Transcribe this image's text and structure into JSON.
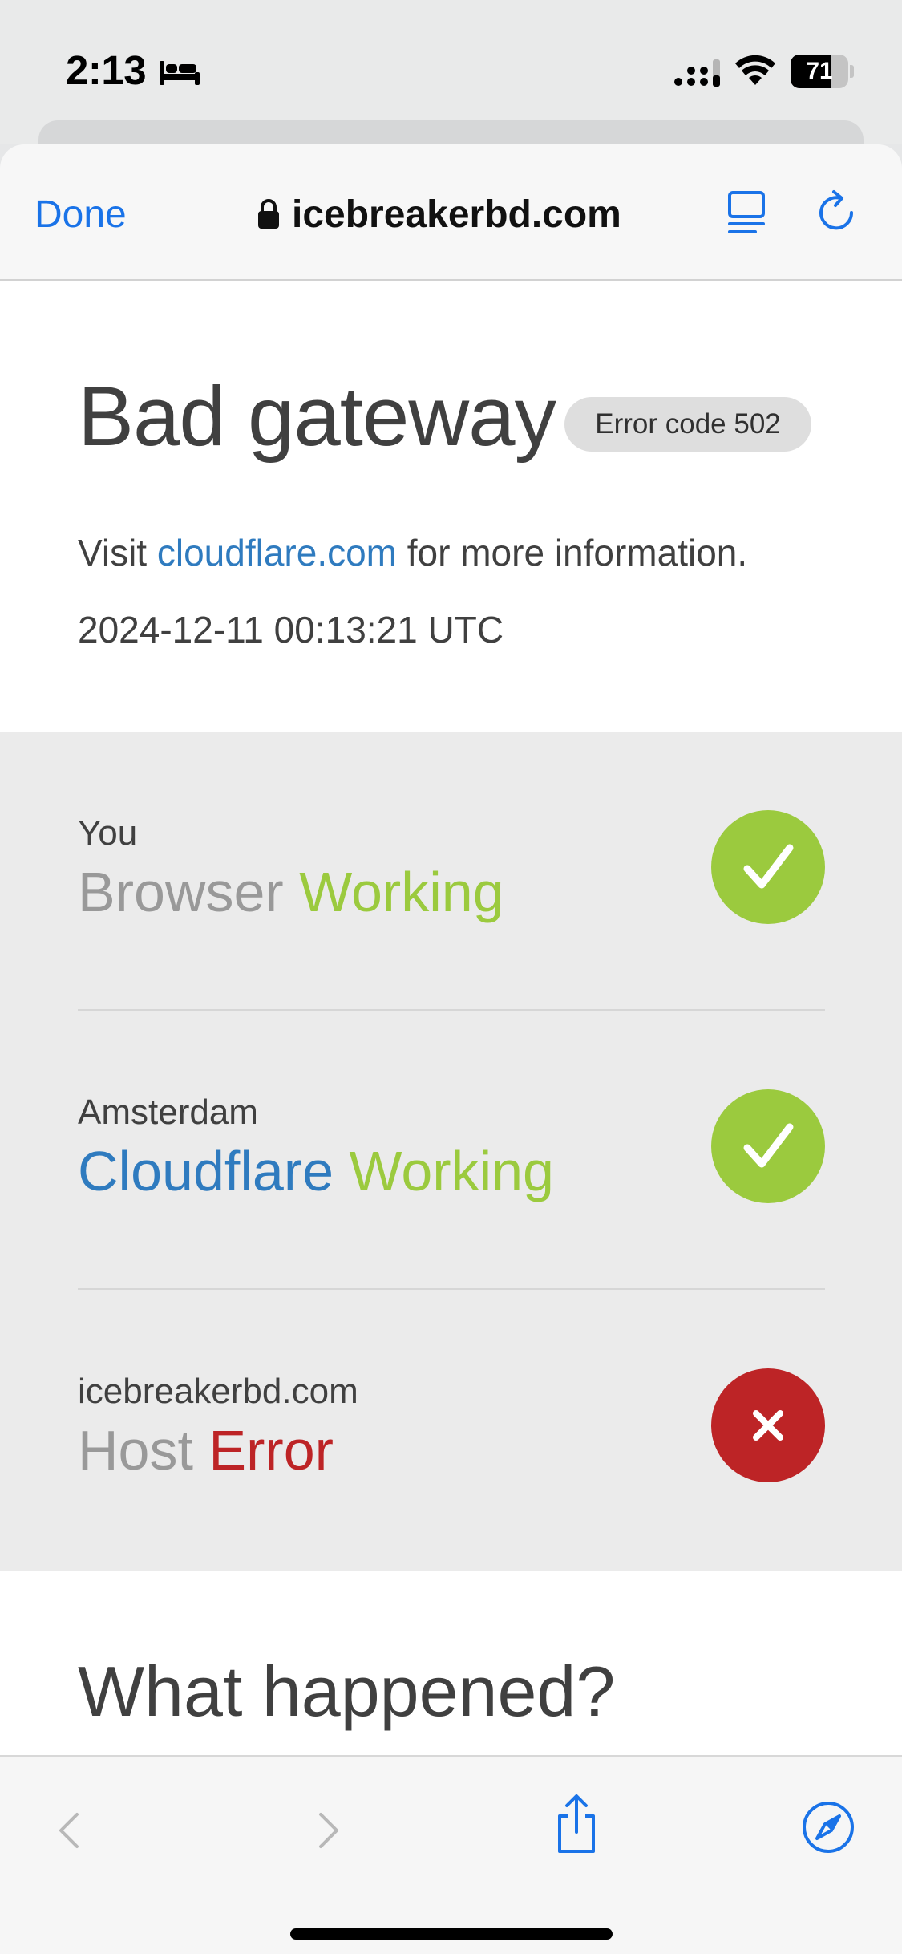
{
  "status_bar": {
    "time": "2:13",
    "battery_level": "71",
    "battery_fraction": 0.71
  },
  "browser": {
    "done_label": "Done",
    "url": "icebreakerbd.com",
    "accent_color": "#1a73e8"
  },
  "page": {
    "title": "Bad gateway",
    "error_badge": "Error code 502",
    "info_prefix": "Visit ",
    "info_link": "cloudflare.com",
    "info_suffix": " for more information.",
    "timestamp": "2024-12-11 00:13:21 UTC",
    "status_rows": [
      {
        "location": "You",
        "entity": "Browser",
        "state": "Working",
        "icon": "check-icon",
        "color": "#9bca3e"
      },
      {
        "location": "Amsterdam",
        "entity": "Cloudflare",
        "state": "Working",
        "icon": "check-icon",
        "color": "#9bca3e"
      },
      {
        "location": "icebreakerbd.com",
        "entity": "Host",
        "state": "Error",
        "icon": "x-icon",
        "color": "#bd2426"
      }
    ],
    "section_title": "What happened?"
  },
  "toolbar": {
    "icons": [
      "back-icon",
      "forward-icon",
      "share-icon",
      "compass-icon"
    ]
  }
}
